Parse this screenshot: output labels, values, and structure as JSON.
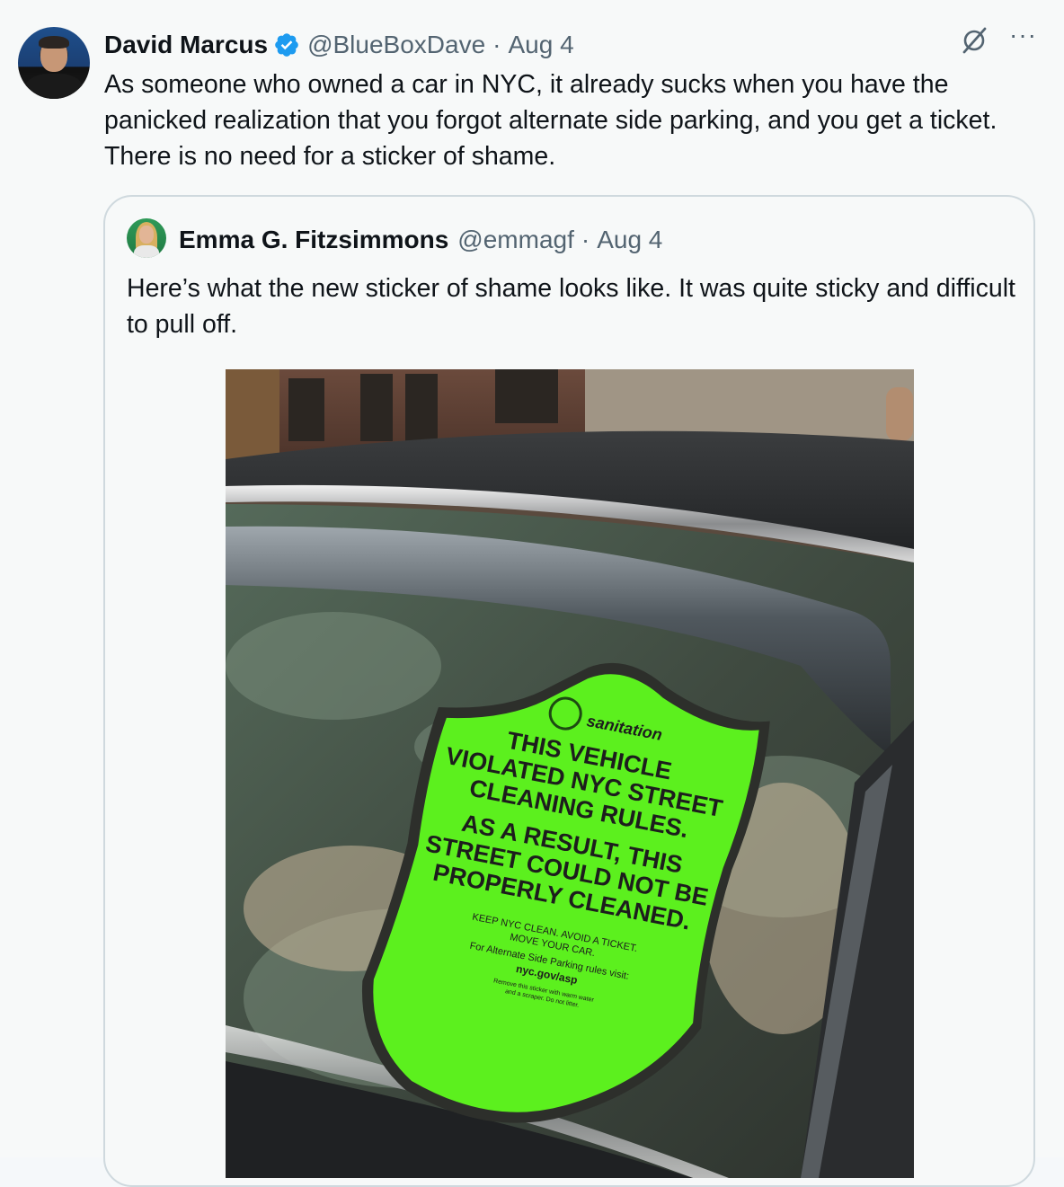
{
  "tweet": {
    "author_name": "David Marcus",
    "author_handle": "@BlueBoxDave",
    "separator": "·",
    "date": "Aug 4",
    "text": "As someone who owned a car in NYC, it already sucks when you have the panicked realization that you forgot alternate side parking, and you get a ticket. There is no need for a sticker of shame.",
    "more_label": "···",
    "icons": {
      "verified": "verified-badge-icon",
      "grok": "grok-icon",
      "more": "more-icon"
    }
  },
  "quote": {
    "author_name": "Emma G. Fitzsimmons",
    "author_handle": "@emmagf",
    "separator": "·",
    "date": "Aug 4",
    "text": "Here’s what the new sticker of shame looks like. It was quite sticky and difficult to pull off."
  },
  "sticker": {
    "brand": "sanitation",
    "line1": "THIS VEHICLE",
    "line2": "VIOLATED NYC STREET",
    "line3": "CLEANING RULES.",
    "line4": "AS A RESULT, THIS",
    "line5": "STREET COULD NOT BE",
    "line6": "PROPERLY CLEANED.",
    "small1": "KEEP NYC CLEAN. AVOID A TICKET.",
    "small2": "MOVE YOUR CAR.",
    "small3": "For Alternate Side Parking rules visit:",
    "url": "nyc.gov/asp",
    "tiny1": "Remove this sticker with warm water",
    "tiny2": "and a scraper. Do not litter.",
    "color": "#5cf01e"
  },
  "colors": {
    "background": "#f7f9f9",
    "text": "#0f1419",
    "secondary": "#536471",
    "verified": "#1d9bf0",
    "border": "#cfd9de"
  }
}
